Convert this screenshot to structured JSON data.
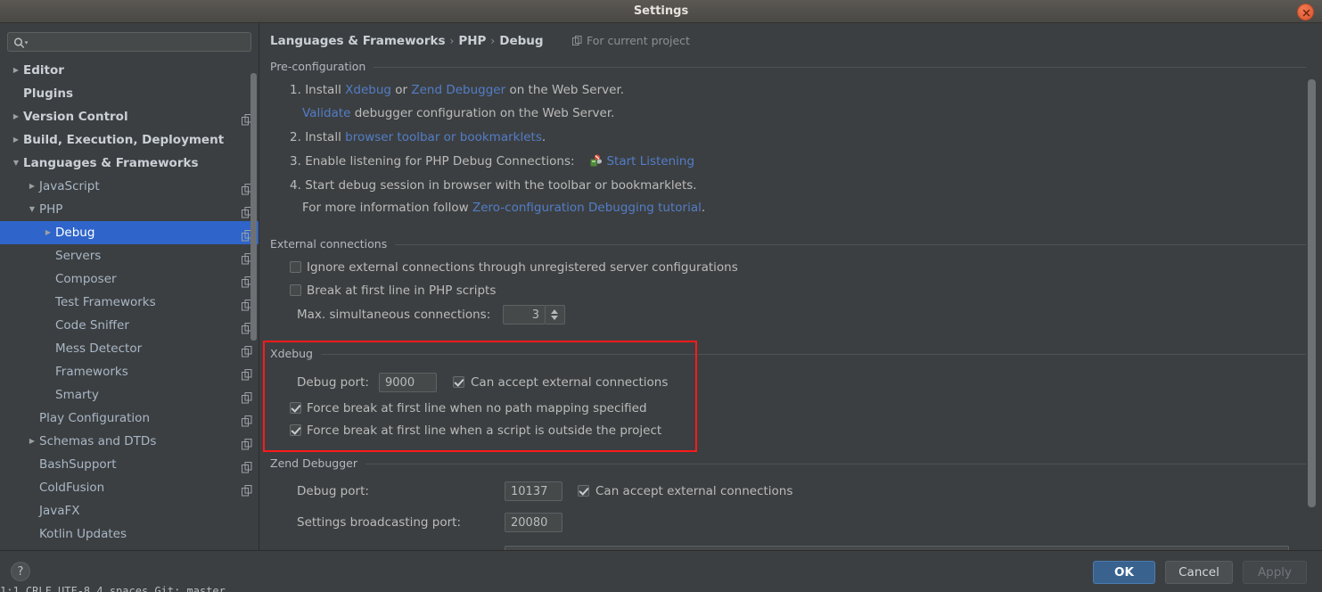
{
  "window": {
    "title": "Settings",
    "close_icon": "close-icon"
  },
  "sidebar": {
    "search": {
      "value": "",
      "placeholder": ""
    },
    "items": [
      {
        "label": "Editor",
        "indent": 0,
        "twisty": "right",
        "bold": true,
        "project_icon": false,
        "selected": false
      },
      {
        "label": "Plugins",
        "indent": 0,
        "twisty": "none",
        "bold": true,
        "project_icon": false,
        "selected": false
      },
      {
        "label": "Version Control",
        "indent": 0,
        "twisty": "right",
        "bold": true,
        "project_icon": true,
        "selected": false
      },
      {
        "label": "Build, Execution, Deployment",
        "indent": 0,
        "twisty": "right",
        "bold": true,
        "project_icon": false,
        "selected": false
      },
      {
        "label": "Languages & Frameworks",
        "indent": 0,
        "twisty": "down",
        "bold": true,
        "project_icon": false,
        "selected": false
      },
      {
        "label": "JavaScript",
        "indent": 1,
        "twisty": "right",
        "bold": false,
        "project_icon": true,
        "selected": false
      },
      {
        "label": "PHP",
        "indent": 1,
        "twisty": "down",
        "bold": false,
        "project_icon": true,
        "selected": false
      },
      {
        "label": "Debug",
        "indent": 2,
        "twisty": "right",
        "bold": false,
        "project_icon": true,
        "selected": true
      },
      {
        "label": "Servers",
        "indent": 2,
        "twisty": "none",
        "bold": false,
        "project_icon": true,
        "selected": false
      },
      {
        "label": "Composer",
        "indent": 2,
        "twisty": "none",
        "bold": false,
        "project_icon": true,
        "selected": false
      },
      {
        "label": "Test Frameworks",
        "indent": 2,
        "twisty": "none",
        "bold": false,
        "project_icon": true,
        "selected": false
      },
      {
        "label": "Code Sniffer",
        "indent": 2,
        "twisty": "none",
        "bold": false,
        "project_icon": true,
        "selected": false
      },
      {
        "label": "Mess Detector",
        "indent": 2,
        "twisty": "none",
        "bold": false,
        "project_icon": true,
        "selected": false
      },
      {
        "label": "Frameworks",
        "indent": 2,
        "twisty": "none",
        "bold": false,
        "project_icon": true,
        "selected": false
      },
      {
        "label": "Smarty",
        "indent": 2,
        "twisty": "none",
        "bold": false,
        "project_icon": true,
        "selected": false
      },
      {
        "label": "Play Configuration",
        "indent": 1,
        "twisty": "none",
        "bold": false,
        "project_icon": true,
        "selected": false
      },
      {
        "label": "Schemas and DTDs",
        "indent": 1,
        "twisty": "right",
        "bold": false,
        "project_icon": true,
        "selected": false
      },
      {
        "label": "BashSupport",
        "indent": 1,
        "twisty": "none",
        "bold": false,
        "project_icon": true,
        "selected": false
      },
      {
        "label": "ColdFusion",
        "indent": 1,
        "twisty": "none",
        "bold": false,
        "project_icon": true,
        "selected": false
      },
      {
        "label": "JavaFX",
        "indent": 1,
        "twisty": "none",
        "bold": false,
        "project_icon": false,
        "selected": false
      },
      {
        "label": "Kotlin Updates",
        "indent": 1,
        "twisty": "none",
        "bold": false,
        "project_icon": false,
        "selected": false
      }
    ]
  },
  "content": {
    "breadcrumb": {
      "part1": "Languages & Frameworks",
      "sep1": "›",
      "part2": "PHP",
      "sep2": "›",
      "part3": "Debug"
    },
    "for_current_project": "For current project",
    "preconfiguration": {
      "group_title": "Pre-configuration",
      "line1_num": "1.",
      "line1_a": "Install",
      "line1_link1": "Xdebug",
      "line1_b": "or",
      "line1_link2": "Zend Debugger",
      "line1_c": "on the Web Server.",
      "line2_link": "Validate",
      "line2_text": "debugger configuration on the Web Server.",
      "line3_num": "2.",
      "line3_a": "Install",
      "line3_link": "browser toolbar or bookmarklets",
      "line3_b": ".",
      "line4_num": "3.",
      "line4_a": "Enable listening for PHP Debug Connections:",
      "line4_link": "Start Listening",
      "line5_num": "4.",
      "line5_a": "Start debug session in browser with the toolbar or bookmarklets.",
      "line6_a": "For more information follow",
      "line6_link": "Zero-configuration Debugging tutorial",
      "line6_b": "."
    },
    "external_connections": {
      "group_title": "External connections",
      "ignore_label": "Ignore external connections through unregistered server configurations",
      "ignore_checked": false,
      "break_label": "Break at first line in PHP scripts",
      "break_checked": false,
      "max_label": "Max. simultaneous connections:",
      "max_value": "3"
    },
    "xdebug": {
      "group_title": "Xdebug",
      "highlighted": true,
      "highlight_color": "#ff1a1a",
      "debug_port_label": "Debug port:",
      "debug_port_value": "9000",
      "accept_label": "Can accept external connections",
      "accept_checked": true,
      "force_nomap_label": "Force break at first line when no path mapping specified",
      "force_nomap_checked": true,
      "force_outside_label": "Force break at first line when a script is outside the project",
      "force_outside_checked": true
    },
    "zend_debugger": {
      "group_title": "Zend Debugger",
      "debug_port_label": "Debug port:",
      "debug_port_value": "10137",
      "accept_label": "Can accept external connections",
      "accept_checked": true,
      "broadcast_label": "Settings broadcasting port:",
      "broadcast_value": "20080"
    }
  },
  "footer": {
    "help_label": "?",
    "ok_label": "OK",
    "cancel_label": "Cancel",
    "apply_label": "Apply",
    "apply_disabled": true
  }
}
